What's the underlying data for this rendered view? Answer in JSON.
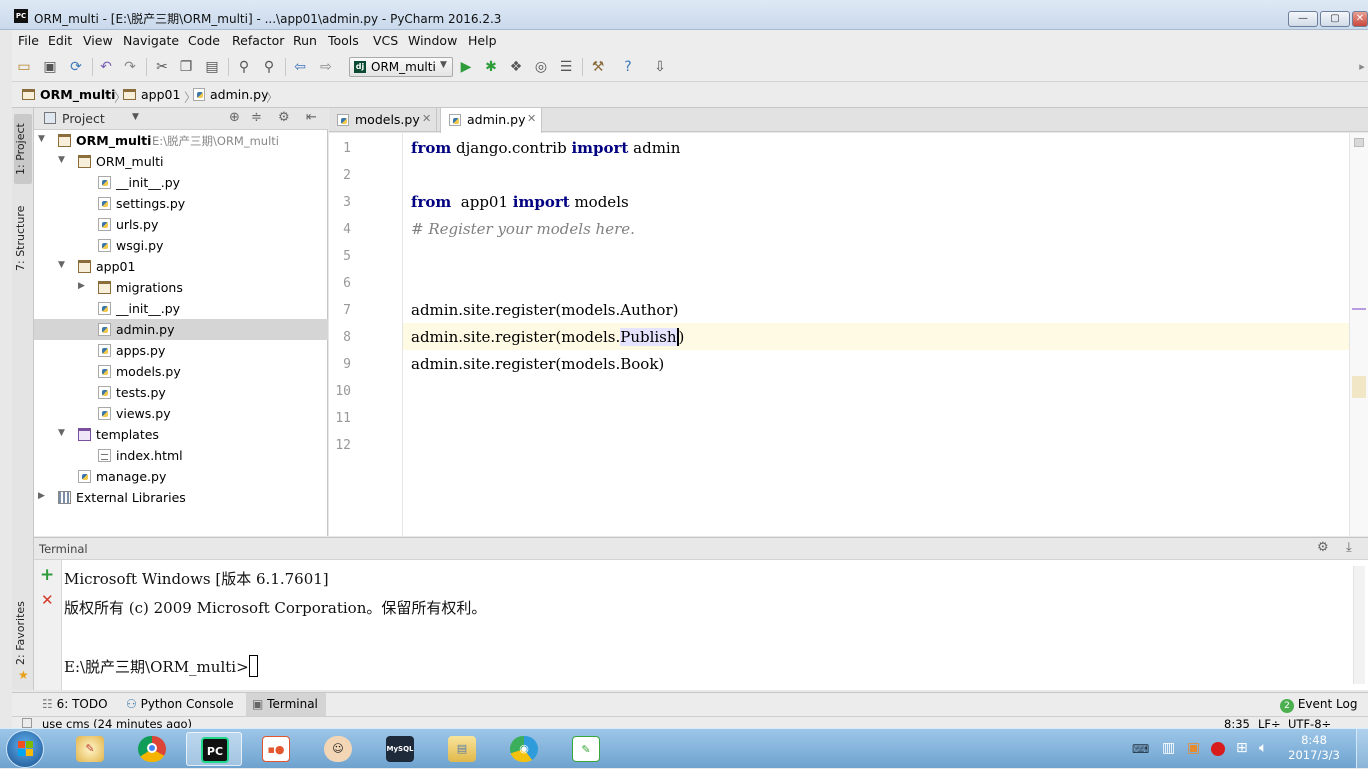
{
  "window": {
    "title": "ORM_multi - [E:\\脱产三期\\ORM_multi] - ...\\app01\\admin.py - PyCharm 2016.2.3",
    "app_icon_text": "PC"
  },
  "menu": [
    "File",
    "Edit",
    "View",
    "Navigate",
    "Code",
    "Refactor",
    "Run",
    "Tools",
    "VCS",
    "Window",
    "Help"
  ],
  "toolbar": {
    "run_config": "ORM_multi"
  },
  "breadcrumb": [
    "ORM_multi",
    "app01",
    "admin.py"
  ],
  "side_tabs": {
    "project": "1: Project",
    "structure": "7: Structure",
    "favorites": "2: Favorites"
  },
  "project_panel": {
    "header": "Project",
    "tree": [
      {
        "label": "ORM_multi",
        "path": "E:\\脱产三期\\ORM_multi",
        "type": "folder",
        "depth": 0,
        "expanded": true,
        "bold": true
      },
      {
        "label": "ORM_multi",
        "type": "folder",
        "depth": 1,
        "expanded": true
      },
      {
        "label": "__init__.py",
        "type": "py",
        "depth": 2
      },
      {
        "label": "settings.py",
        "type": "py",
        "depth": 2
      },
      {
        "label": "urls.py",
        "type": "py",
        "depth": 2
      },
      {
        "label": "wsgi.py",
        "type": "py",
        "depth": 2
      },
      {
        "label": "app01",
        "type": "folder",
        "depth": 1,
        "expanded": true
      },
      {
        "label": "migrations",
        "type": "folder",
        "depth": 2,
        "expanded": false
      },
      {
        "label": "__init__.py",
        "type": "py",
        "depth": 2
      },
      {
        "label": "admin.py",
        "type": "py",
        "depth": 2,
        "selected": true
      },
      {
        "label": "apps.py",
        "type": "py",
        "depth": 2
      },
      {
        "label": "models.py",
        "type": "py",
        "depth": 2
      },
      {
        "label": "tests.py",
        "type": "py",
        "depth": 2
      },
      {
        "label": "views.py",
        "type": "py",
        "depth": 2
      },
      {
        "label": "templates",
        "type": "folder",
        "depth": 1,
        "expanded": true
      },
      {
        "label": "index.html",
        "type": "html",
        "depth": 2
      },
      {
        "label": "manage.py",
        "type": "py",
        "depth": 1
      },
      {
        "label": "External Libraries",
        "type": "lib",
        "depth": 0,
        "expanded": false
      }
    ]
  },
  "editor_tabs": [
    {
      "label": "models.py",
      "active": false
    },
    {
      "label": "admin.py",
      "active": true
    }
  ],
  "editor": {
    "line_numbers": [
      "1",
      "2",
      "3",
      "4",
      "5",
      "6",
      "7",
      "8",
      "9",
      "10",
      "11",
      "12"
    ],
    "lines": {
      "l1_kw1": "from",
      "l1_mod": " django.contrib ",
      "l1_kw2": "import",
      "l1_name": " admin",
      "l3_kw1": "from",
      "l3_mod": "  app01 ",
      "l3_kw2": "import",
      "l3_name": " models",
      "l4_comment": "# Register your models here.",
      "l7": "admin.site.register(models.Author)",
      "l8_pre": "admin.site.register(models.",
      "l8_hl": "Publish",
      "l8_post": ")",
      "l9": "admin.site.register(models.Book)"
    }
  },
  "terminal": {
    "title": "Terminal",
    "lines": [
      "Microsoft Windows [版本 6.1.7601]",
      "版权所有 (c) 2009 Microsoft Corporation。保留所有权利。",
      "",
      "E:\\脱产三期\\ORM_multi>"
    ]
  },
  "bottom_tabs": {
    "todo": "6: TODO",
    "python_console": "Python Console",
    "terminal": "Terminal",
    "event_log": "Event Log",
    "event_count": "2"
  },
  "status": {
    "message": "use cms (24 minutes ago)",
    "position": "8:35",
    "line_sep": "LF÷",
    "encoding": "UTF-8÷"
  },
  "taskbar": {
    "time": "8:48",
    "date": "2017/3/3",
    "apps": [
      "start",
      "paint",
      "chrome",
      "pycharm",
      "presentation",
      "person",
      "mysql",
      "explorer",
      "browser",
      "notepad"
    ]
  },
  "colors": {
    "keyword": "#000080",
    "comment": "#808080",
    "current_line": "#fffae3",
    "selection": "#e4e4ff"
  }
}
